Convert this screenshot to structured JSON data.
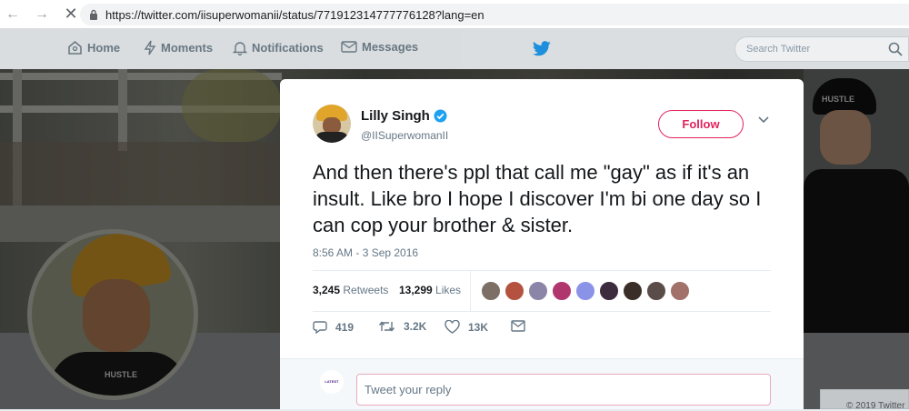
{
  "browser": {
    "url": "https://twitter.com/iisuperwomanii/status/771912314777776128?lang=en"
  },
  "nav": {
    "home": "Home",
    "moments": "Moments",
    "notifications": "Notifications",
    "messages": "Messages",
    "search_placeholder": "Search Twitter"
  },
  "tweet": {
    "name": "Lilly Singh",
    "handle": "@IISuperwomanII",
    "follow": "Follow",
    "text": "And then there's ppl that call me \"gay\" as if it's an insult. Like bro I hope I discover I'm bi one day so I can cop your brother & sister.",
    "timestamp": "8:56 AM - 3 Sep 2016",
    "retweets_count": "3,245",
    "retweets_label": "Retweets",
    "likes_count": "13,299",
    "likes_label": "Likes",
    "replies": "419",
    "retweet_action": "3.2K",
    "like_action": "13K",
    "reply_placeholder": "Tweet your reply",
    "mini_avatar_text": "LATEST"
  },
  "footer": {
    "copyright": "© 2019 Twitter"
  },
  "colors": {
    "accent": "#e0245e",
    "verified": "#1da1f2",
    "brand": "#1da1f2"
  }
}
